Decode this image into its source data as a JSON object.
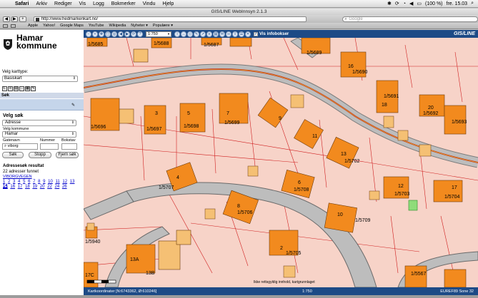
{
  "menubar": {
    "items": [
      "Safari",
      "Arkiv",
      "Rediger",
      "Vis",
      "Logg",
      "Bokmerker",
      "Vindu",
      "Hjelp"
    ],
    "battery": "(100 %)",
    "clock": "fre. 15.03"
  },
  "window": {
    "title": "GIS/LINE WebInnsyn 2.1.3"
  },
  "toolbar": {
    "url": "http://www.hedmarkenkart.no/",
    "search_placeholder": "Google"
  },
  "bookmarks": [
    "Apple",
    "Yahoo!",
    "Google Maps",
    "YouTube",
    "Wikipedia",
    "Nyheter ▾",
    "Populære ▾"
  ],
  "sidebar": {
    "kommune": "Hamar\nkommune",
    "kommune_line1": "Hamar",
    "kommune_line2": "kommune",
    "velg_karttype_label": "Velg karttype:",
    "karttype_value": "Basiskart",
    "sok_header": "Søk",
    "velg_sok": "Velg søk",
    "sok_type": "Adresse",
    "velg_kommune_label": "Velg kommune",
    "kommune_value": "Hamar",
    "gatenavn_label": "Gatenavn",
    "nummer_label": "Nummer",
    "bokstav_label": "Bokstav",
    "gatenavn_value": "viborg",
    "sok_button": "Søk",
    "stopp_button": "Stopp",
    "fjern_button": "Fjern søk",
    "result_title": "Adressesøk resultat",
    "result_count": "22 adresser funnet",
    "result_link": "VIBORGVEGEN",
    "pages_row1": [
      "1",
      "2",
      "3",
      "4",
      "5",
      "6",
      "7",
      "8",
      "9",
      "10",
      "11",
      "12",
      "13",
      "14"
    ],
    "pages_row2": [
      "15",
      "16",
      "17",
      "18",
      "19",
      "20",
      "22",
      "24",
      "26"
    ]
  },
  "map_toolbar": {
    "scale_value": "1:750",
    "info_label": "Vis infobokser",
    "logo": "GIS/LINE"
  },
  "map": {
    "parcel_labels": [
      "1/5685",
      "1/5688",
      "1/5687",
      "1/5689",
      "1/5690",
      "1/5691",
      "1/5692",
      "1/5693",
      "1/5696",
      "1/5697",
      "1/5698",
      "1/5699",
      "1/5702",
      "1/5703",
      "1/5704",
      "1/5707",
      "1/5708",
      "1/5706",
      "1/5709",
      "1/5705",
      "1/5940",
      "1/5567"
    ],
    "house_numbers": [
      "16",
      "18",
      "20",
      "3",
      "5",
      "7",
      "9",
      "11",
      "13",
      "4",
      "6",
      "8",
      "10",
      "12",
      "2",
      "17",
      "13A",
      "13B",
      "17C"
    ],
    "credit": "Ikke rettsgyldig innhold, kartgrunnlaget"
  },
  "statusbar": {
    "coords": "Kartkoordinater [N:6743362, Ø:610246]",
    "scale": "1:750",
    "system": "EUREF89 Sone 32"
  },
  "colors": {
    "map_background": "#f7d3c8",
    "building_main": "#f28a1e",
    "building_annex": "#f5c074",
    "road": "#b9b9b9",
    "road_center": "#c0302a",
    "toolbar_blue": "#1d4a86"
  }
}
